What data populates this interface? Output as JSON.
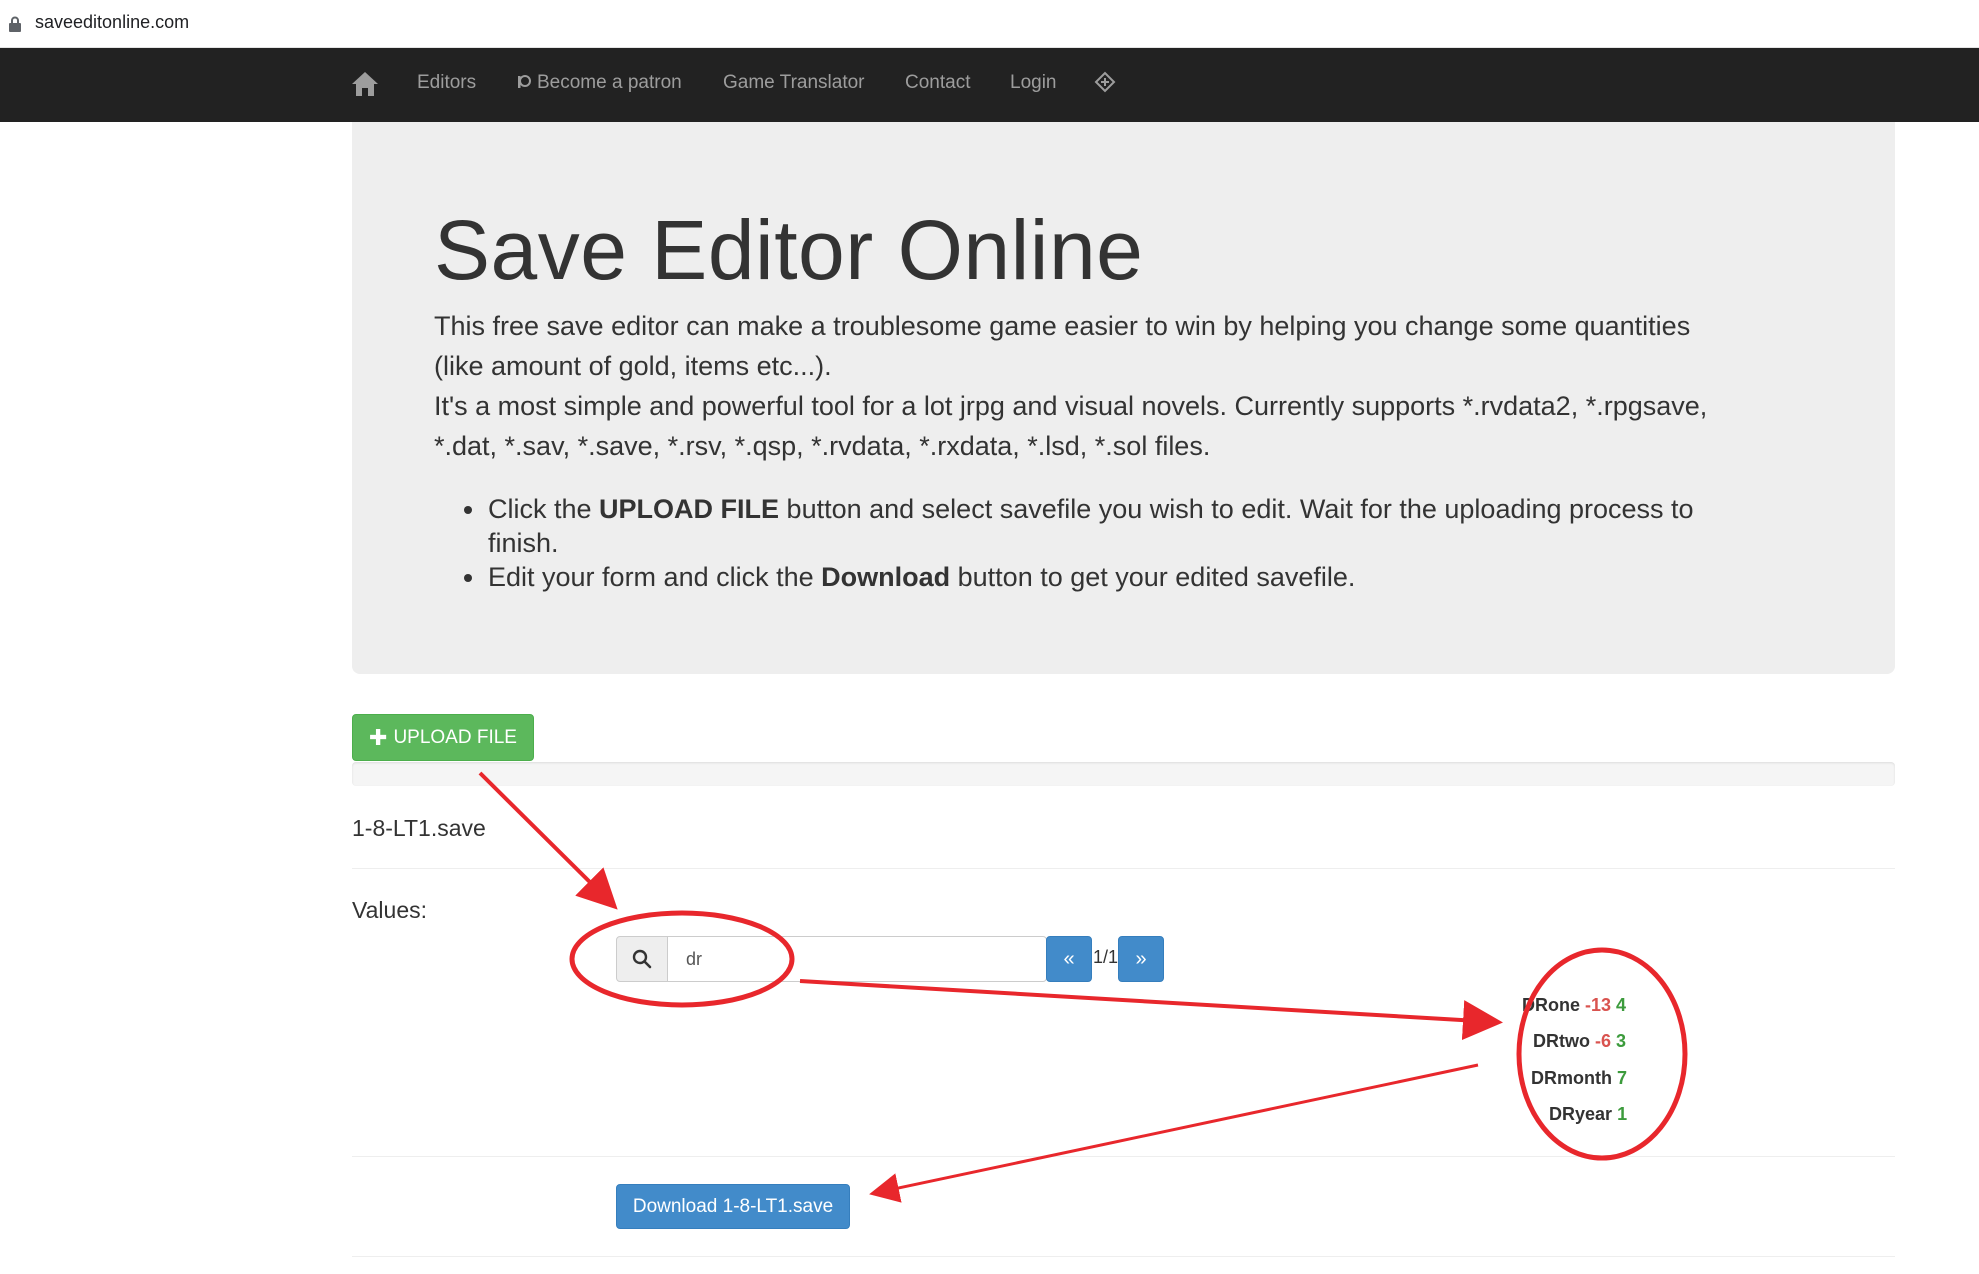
{
  "browser": {
    "url": "saveeditonline.com"
  },
  "nav": {
    "items": [
      {
        "label": "Editors"
      },
      {
        "label": "Become a patron"
      },
      {
        "label": "Game Translator"
      },
      {
        "label": "Contact"
      },
      {
        "label": "Login"
      }
    ]
  },
  "hero": {
    "title": "Save Editor Online",
    "p1_line1": "This free save editor can make a troublesome game easier to win by helping you change some quantities",
    "p1_line2": "(like amount of gold, items etc...).",
    "p2_line1": "It's a most simple and powerful tool for a lot jrpg and visual novels. Currently supports *.rvdata2, *.rpgsave,",
    "p2_line2": "*.dat, *.sav, *.save, *.rsv, *.qsp, *.rvdata, *.rxdata, *.lsd, *.sol files.",
    "bullets": [
      {
        "pre": "Click the ",
        "strong": "UPLOAD FILE",
        "post": " button and select savefile you wish to edit. Wait for the uploading process to",
        "cont": "finish."
      },
      {
        "pre": "Edit your form and click the ",
        "strong": "Download",
        "post": " button to get your edited savefile.",
        "cont": ""
      }
    ]
  },
  "upload": {
    "label": "UPLOAD FILE"
  },
  "file": {
    "name": "1-8-LT1.save"
  },
  "values": {
    "label": "Values:",
    "search_value": "dr",
    "prev": "«",
    "next": "»",
    "page": "1/1",
    "rows": [
      {
        "name": "DRone",
        "old": "-13",
        "new": "4"
      },
      {
        "name": "DRtwo",
        "old": "-6",
        "new": "3"
      },
      {
        "name": "DRmonth",
        "old": "",
        "new": "7"
      },
      {
        "name": "DRyear",
        "old": "",
        "new": "1"
      }
    ]
  },
  "download": {
    "label": "Download 1-8-LT1.save"
  },
  "colors": {
    "navbar": "#222222",
    "nav_text": "#9d9d9d",
    "jumbotron": "#eeeeee",
    "success": "#5cb85c",
    "primary": "#428bca",
    "annotation": "#e8272c"
  }
}
